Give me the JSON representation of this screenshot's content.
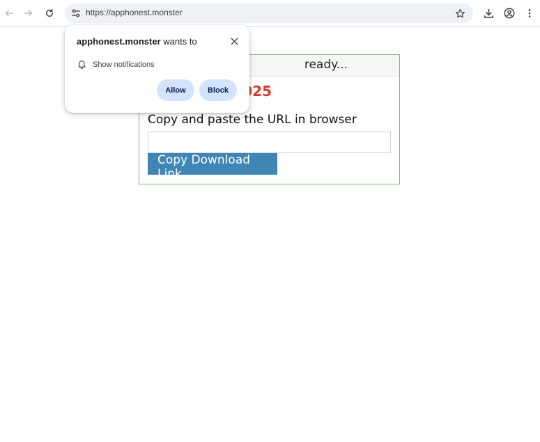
{
  "browser": {
    "url": "https://apphonest.monster",
    "icons": {
      "back": "arrow-left-icon",
      "forward": "arrow-right-icon",
      "reload": "reload-icon",
      "site_info": "tune-icon",
      "bookmark": "star-icon",
      "downloads": "download-icon",
      "profile": "profile-icon",
      "menu": "kebab-menu-icon"
    }
  },
  "permission_popup": {
    "site": "apphonest.monster",
    "wants_to": "wants to",
    "permission_label": "Show notifications",
    "allow_label": "Allow",
    "block_label": "Block",
    "icons": {
      "close": "close-icon",
      "permission": "bell-icon"
    }
  },
  "page": {
    "header_visible_text": "ready...",
    "year_visible_text": "025",
    "copy_label": "Copy and paste the URL in browser",
    "url_field_value": "",
    "button_label": "Copy Download Link"
  },
  "colors": {
    "box_border": "#79b779",
    "year_red": "#d13b2a",
    "button_blue": "#3f86b4",
    "pill_bg": "#d3e3fd"
  }
}
